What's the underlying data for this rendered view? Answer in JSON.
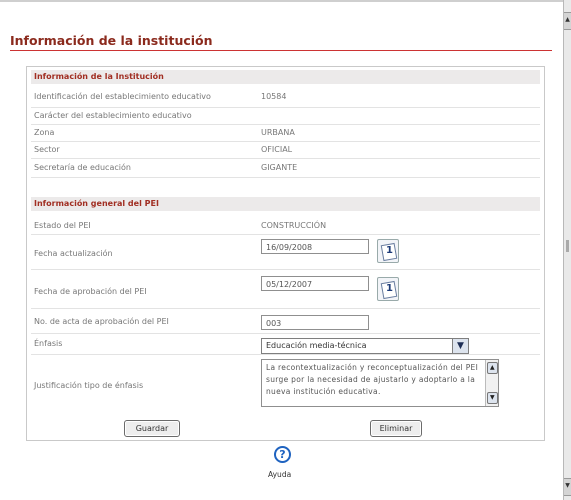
{
  "page": {
    "title": "Información de la institución"
  },
  "section1": {
    "header": "Información de la Institución",
    "rows": [
      {
        "label": "Identificación del establecimiento educativo",
        "value": "10584"
      },
      {
        "label": "Carácter del establecimiento educativo",
        "value": ""
      },
      {
        "label": "Zona",
        "value": "URBANA"
      },
      {
        "label": "Sector",
        "value": "OFICIAL"
      },
      {
        "label": "Secretaría de educación",
        "value": "GIGANTE"
      }
    ]
  },
  "section2": {
    "header": "Información general del PEI",
    "estado": {
      "label": "Estado del PEI",
      "value": "CONSTRUCCIÓN"
    },
    "fecha_actualizacion": {
      "label": "Fecha actualización",
      "value": "16/09/2008",
      "cal_icon": "calendar-icon",
      "cal_num": "1"
    },
    "fecha_aprobacion": {
      "label": "Fecha de aprobación del PEI",
      "value": "05/12/2007",
      "cal_icon": "calendar-icon",
      "cal_num": "1"
    },
    "acta": {
      "label": "No. de acta de aprobación del PEI",
      "value": "003"
    },
    "enfasis": {
      "label": "Énfasis",
      "selected": "Educación media-técnica"
    },
    "justificacion": {
      "label": "Justificación tipo de énfasis",
      "text": "La recontextualización y reconceptualización del PEI surge por la necesidad de ajustarlo y adoptarlo a la nueva institución educativa."
    }
  },
  "buttons": {
    "save": "Guardar",
    "delete": "Eliminar"
  },
  "help": {
    "icon": "help-icon",
    "glyph": "?",
    "label": "Ayuda"
  },
  "colors": {
    "title": "#8b2a1d",
    "section_header_text": "#a12f23",
    "rule": "#cc3333",
    "help": "#1f63c0"
  }
}
